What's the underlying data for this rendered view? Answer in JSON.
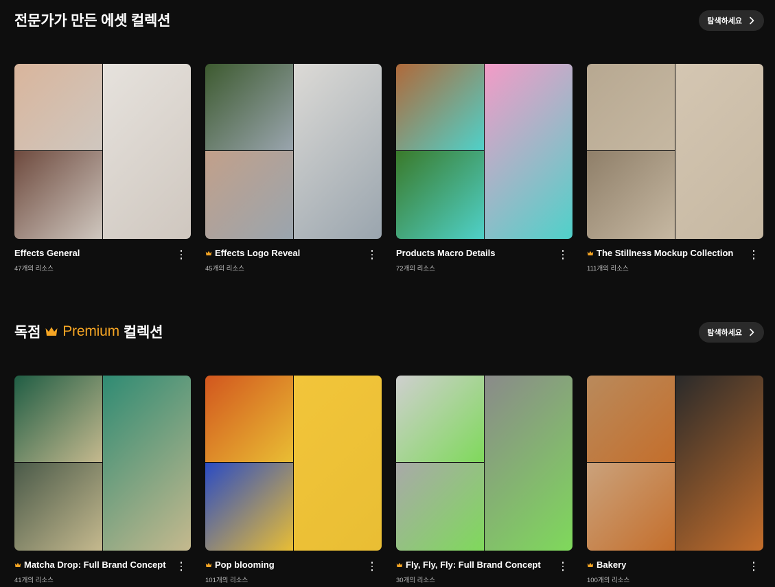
{
  "sections": [
    {
      "title": "전문가가 만든 에셋 컬렉션",
      "explore_label": "탐색하세요",
      "cards": [
        {
          "title": "Effects General",
          "count": "47개의 리소스",
          "premium": false,
          "colors": [
            "#d9b59c",
            "#e6e2dd",
            "#6e4a3e",
            "#cfc7bf"
          ]
        },
        {
          "title": "Effects Logo Reveal",
          "count": "45개의 리소스",
          "premium": true,
          "colors": [
            "#3d5a2f",
            "#dcdad6",
            "#c2a08a",
            "#9aa5ae"
          ]
        },
        {
          "title": "Products Macro Details",
          "count": "72개의 리소스",
          "premium": false,
          "colors": [
            "#b0693a",
            "#f49bc7",
            "#3a7a2a",
            "#4fd1c9"
          ]
        },
        {
          "title": "The Stillness Mockup Collection",
          "count": "111개의 리소스",
          "premium": true,
          "colors": [
            "#b7a891",
            "#d4c6b2",
            "#8f7f69",
            "#c6b8a2"
          ]
        }
      ]
    },
    {
      "title_prefix": "독점",
      "title_premium": "Premium",
      "title_suffix": "컬렉션",
      "explore_label": "탐색하세요",
      "cards": [
        {
          "title": "Matcha Drop: Full Brand Concept",
          "count": "41개의 리소스",
          "premium": true,
          "colors": [
            "#1f5d44",
            "#2f8b73",
            "#4a5a49",
            "#c5b98e"
          ]
        },
        {
          "title": "Pop blooming",
          "count": "101개의 리소스",
          "premium": true,
          "colors": [
            "#d2561e",
            "#f2c53a",
            "#2a4bc4",
            "#e9be34"
          ]
        },
        {
          "title": "Fly, Fly, Fly: Full Brand Concept",
          "count": "30개의 리소스",
          "premium": true,
          "colors": [
            "#cfcfcf",
            "#8a8a8a",
            "#a9a9a9",
            "#7fd95b"
          ]
        },
        {
          "title": "Bakery",
          "count": "100개의 리소스",
          "premium": true,
          "colors": [
            "#b98a5c",
            "#2a2a2a",
            "#caa27c",
            "#c46e2b"
          ]
        }
      ]
    }
  ],
  "accent_color": "#f5a524"
}
